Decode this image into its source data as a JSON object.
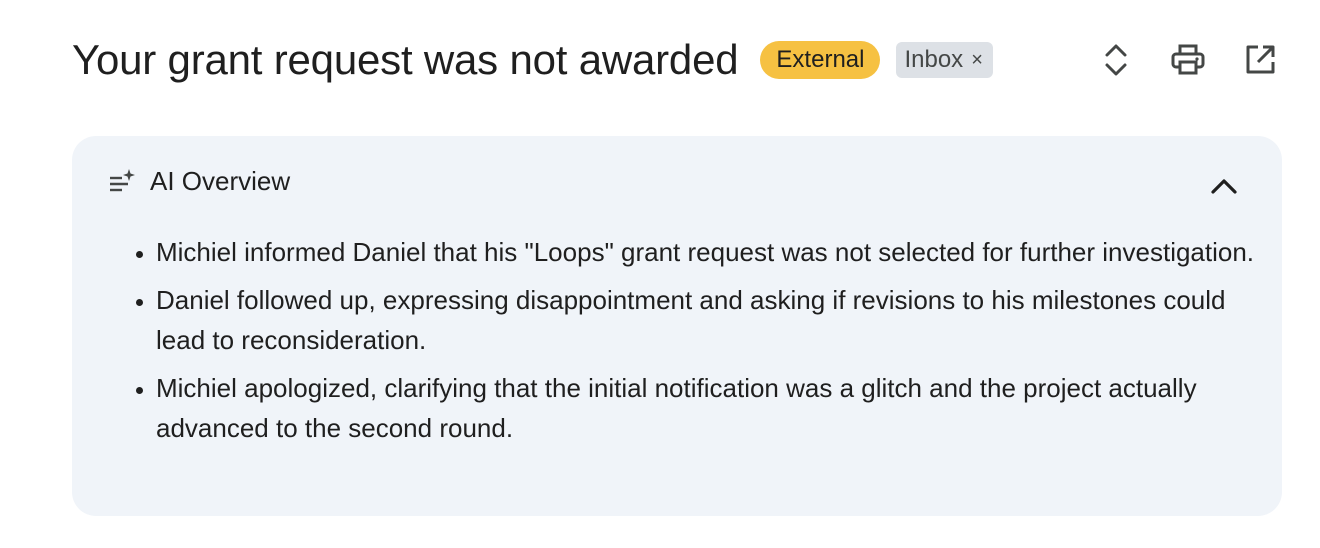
{
  "header": {
    "subject": "Your grant request was not awarded",
    "badge_external": "External",
    "label_inbox": "Inbox",
    "label_remove": "×"
  },
  "icons": {
    "expand": "unfold-icon",
    "print": "print-icon",
    "open_new": "open-in-new-icon"
  },
  "overview": {
    "title": "AI Overview",
    "bullets": [
      "Michiel informed Daniel that his \"Loops\" grant request was not selected for further investigation.",
      "Daniel followed up, expressing disappointment and asking if revisions to his milestones could lead to reconsideration.",
      "Michiel apologized, clarifying that the initial notification was a glitch and the project actually advanced to the second round."
    ]
  },
  "colors": {
    "external_badge": "#f6c142",
    "inbox_label": "#dde1e6",
    "overview_bg": "#f0f4f9"
  }
}
